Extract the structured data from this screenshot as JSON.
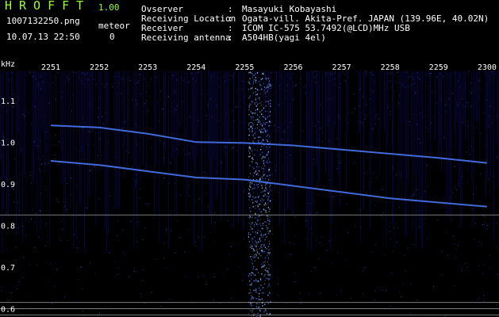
{
  "app": {
    "logo": "HROFFT",
    "version": "1.00",
    "filename": "1007132250.png",
    "datetime": "10.07.13 22:50",
    "meteor_label": "meteor",
    "meteor_count": "0"
  },
  "info": [
    {
      "key": "Ovserver",
      "value": "Masayuki Kobayashi"
    },
    {
      "key": "Receiving Location",
      "value": "Ogata-vill. Akita-Pref. JAPAN (139.96E, 40.02N)"
    },
    {
      "key": "Receiver",
      "value": "ICOM IC-575 53.7492(@LCD)MHz USB"
    },
    {
      "key": "Receiving antenna",
      "value": "A504HB(yagi 4el)"
    }
  ],
  "info_separator": ":",
  "chart_data": {
    "type": "heatmap",
    "ylabel": "kHz",
    "x_ticks": [
      "2251",
      "2252",
      "2253",
      "2254",
      "2255",
      "2256",
      "2257",
      "2258",
      "2259",
      "2300"
    ],
    "y_ticks": [
      "1.1",
      "1.0",
      "0.9",
      "0.8",
      "0.7",
      "0.6"
    ],
    "ylim": [
      0.58,
      1.17
    ],
    "traces": [
      {
        "points": [
          [
            0.0,
            1.04
          ],
          [
            1.0,
            1.035
          ],
          [
            2.0,
            1.02
          ],
          [
            3.0,
            1.0
          ],
          [
            4.0,
            0.998
          ],
          [
            5.0,
            0.992
          ],
          [
            6.0,
            0.982
          ],
          [
            7.0,
            0.972
          ],
          [
            8.0,
            0.962
          ],
          [
            9.0,
            0.95
          ]
        ]
      },
      {
        "points": [
          [
            0.0,
            0.955
          ],
          [
            1.0,
            0.945
          ],
          [
            2.0,
            0.93
          ],
          [
            3.0,
            0.915
          ],
          [
            4.0,
            0.91
          ],
          [
            5.0,
            0.895
          ],
          [
            6.0,
            0.88
          ],
          [
            7.0,
            0.865
          ],
          [
            8.0,
            0.855
          ],
          [
            9.0,
            0.845
          ]
        ]
      }
    ],
    "burst_minute": 4.3,
    "reference_lines": [
      0.825,
      0.615,
      0.6,
      0.585
    ],
    "colors": {
      "background": "#000000",
      "noise": "#0a0a8c",
      "trace": "#4d7dff",
      "burst": "#a6d6ff",
      "text_green": "#9bff33",
      "reference": "#b0b0b0"
    }
  }
}
